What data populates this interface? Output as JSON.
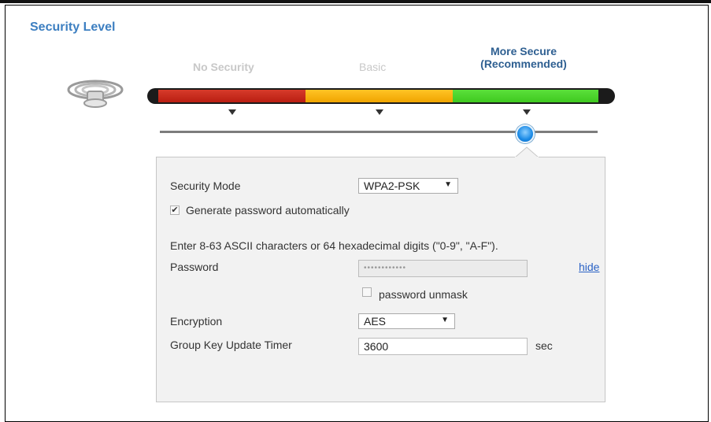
{
  "section_title": "Security Level",
  "levels": [
    {
      "label": "No Security"
    },
    {
      "label": "Basic"
    },
    {
      "label": "More Secure\n(Recommended)"
    }
  ],
  "selected_level": "More Secure (Recommended)",
  "colors": {
    "accent": "#3d7fc1",
    "red": "#c62a1c",
    "yellow": "#fbb612",
    "green": "#4cd42a"
  },
  "form": {
    "security_mode": {
      "label": "Security Mode",
      "value": "WPA2-PSK"
    },
    "generate_password": {
      "label": "Generate password automatically",
      "checked": true
    },
    "hint": "Enter 8-63 ASCII characters or 64 hexadecimal digits (\"0-9\", \"A-F\").",
    "password": {
      "label": "Password",
      "value": "••••••••••••",
      "hide_link": "hide"
    },
    "unmask": {
      "label": "password unmask",
      "checked": false
    },
    "encryption": {
      "label": "Encryption",
      "value": "AES"
    },
    "group_key": {
      "label": "Group Key Update Timer",
      "value": "3600",
      "unit": "sec"
    }
  }
}
